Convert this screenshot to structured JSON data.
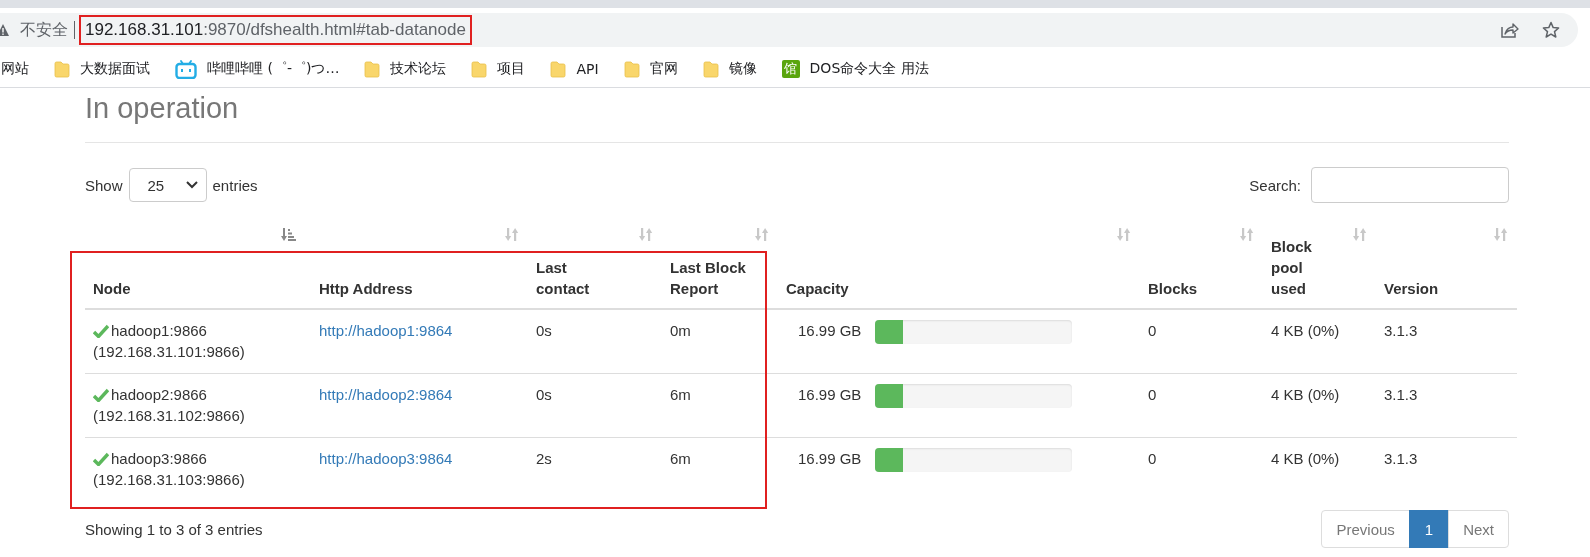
{
  "browser": {
    "security_label": "不安全",
    "url_host": "192.168.31.101",
    "url_rest": ":9870/dfshealth.html#tab-datanode",
    "url_highlighted": true
  },
  "bookmarks": [
    {
      "kind": "plain",
      "label": "网站"
    },
    {
      "kind": "folder",
      "label": "大数据面试"
    },
    {
      "kind": "tv",
      "label": "哔哩哔哩 (゜-゜)つ…"
    },
    {
      "kind": "folder",
      "label": "技术论坛"
    },
    {
      "kind": "folder",
      "label": "项目"
    },
    {
      "kind": "folder",
      "label": "API"
    },
    {
      "kind": "folder",
      "label": "官网"
    },
    {
      "kind": "folder",
      "label": "镜像"
    },
    {
      "kind": "badge",
      "badge_text": "馆",
      "label": "DOS命令大全 用法"
    }
  ],
  "section_title": "In operation",
  "length_control": {
    "prefix": "Show",
    "value": "25",
    "suffix": "entries"
  },
  "search": {
    "label": "Search:"
  },
  "table": {
    "columns": [
      {
        "label": "Node",
        "sorted": true,
        "highlighted": true
      },
      {
        "label": "Http Address",
        "sorted": false,
        "highlighted": true
      },
      {
        "label": "Last contact",
        "sorted": false,
        "highlighted": true
      },
      {
        "label": "Last Block Report",
        "sorted": false,
        "highlighted": true
      },
      {
        "label": "Capacity",
        "sorted": false,
        "highlighted": false
      },
      {
        "label": "Blocks",
        "sorted": false,
        "highlighted": false
      },
      {
        "label": "Block pool used",
        "sorted": false,
        "highlighted": false
      },
      {
        "label": "Version",
        "sorted": false,
        "highlighted": false
      }
    ],
    "rows": [
      {
        "alive": true,
        "node": "hadoop1:9866",
        "node_address": "(192.168.31.101:9866)",
        "http_address": "http://hadoop1:9864",
        "last_contact": "0s",
        "last_block_report": "0m",
        "capacity": "16.99 GB",
        "level": 0.14,
        "blocks": "0",
        "block_pool_used": "4 KB (0%)",
        "version": "3.1.3"
      },
      {
        "alive": true,
        "node": "hadoop2:9866",
        "node_address": "(192.168.31.102:9866)",
        "http_address": "http://hadoop2:9864",
        "last_contact": "0s",
        "last_block_report": "6m",
        "capacity": "16.99 GB",
        "level": 0.14,
        "blocks": "0",
        "block_pool_used": "4 KB (0%)",
        "version": "3.1.3"
      },
      {
        "alive": true,
        "node": "hadoop3:9866",
        "node_address": "(192.168.31.103:9866)",
        "http_address": "http://hadoop3:9864",
        "last_contact": "2s",
        "last_block_report": "6m",
        "capacity": "16.99 GB",
        "level": 0.14,
        "blocks": "0",
        "block_pool_used": "4 KB (0%)",
        "version": "3.1.3"
      }
    ]
  },
  "info": "Showing 1 to 3 of 3 entries",
  "pagination": [
    {
      "label": "Previous",
      "selected": false
    },
    {
      "label": "1",
      "selected": true
    },
    {
      "label": "Next",
      "selected": false
    }
  ]
}
